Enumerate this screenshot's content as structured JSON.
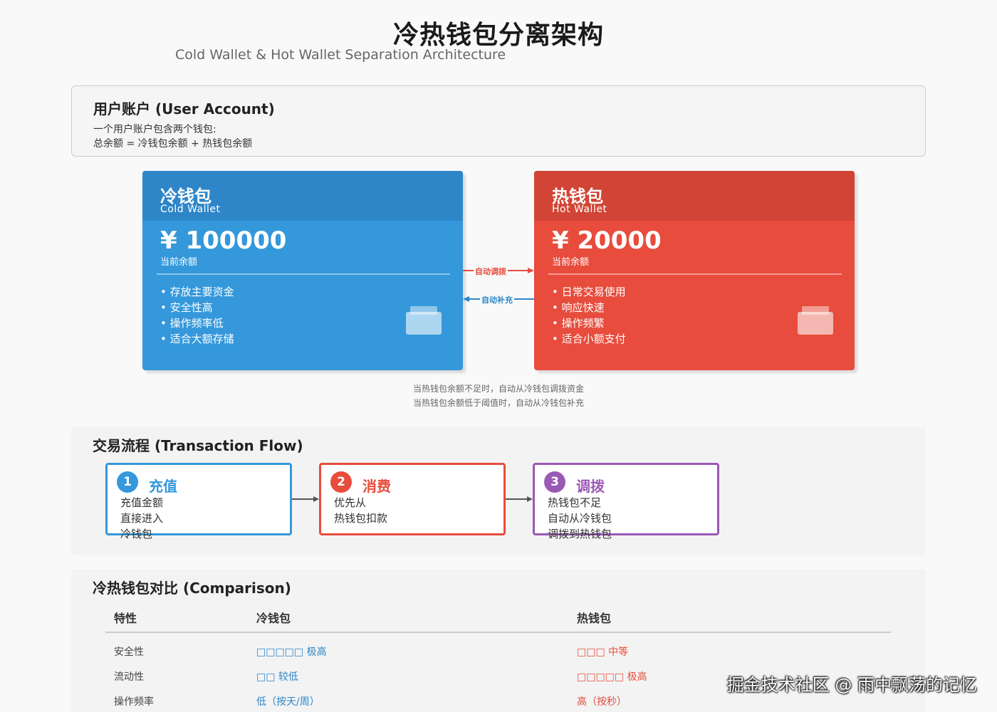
{
  "header": {
    "title": "冷热钱包分离架构",
    "subtitle": "Cold Wallet & Hot Wallet Separation Architecture"
  },
  "user_account": {
    "title": "用户账户 (User Account)",
    "line1": "一个用户账户包含两个钱包:",
    "line2": "总余额 = 冷钱包余额 + 热钱包余额"
  },
  "cold_wallet": {
    "name": "冷钱包",
    "en": "Cold Wallet",
    "amount": "¥ 100000",
    "amount_label": "当前余额",
    "features": [
      "• 存放主要资金",
      "• 安全性高",
      "• 操作频率低",
      "• 适合大额存储"
    ],
    "color": "#3498db",
    "icon": "wallet-icon"
  },
  "hot_wallet": {
    "name": "热钱包",
    "en": "Hot Wallet",
    "amount": "¥ 20000",
    "amount_label": "当前余额",
    "features": [
      "• 日常交易使用",
      "• 响应快速",
      "• 操作频繁",
      "• 适合小额支付"
    ],
    "color": "#e74c3c",
    "icon": "wallet-icon"
  },
  "arrows": {
    "to_hot": "自动调拨",
    "to_cold": "自动补充"
  },
  "notes": {
    "line1": "当热钱包余额不足时，自动从冷钱包调拨资金",
    "line2": "当热钱包余额低于阈值时，自动从冷钱包补充"
  },
  "flow": {
    "title": "交易流程 (Transaction Flow)",
    "steps": [
      {
        "num": "1",
        "title": "充值",
        "lines": [
          "充值金额",
          "直接进入",
          "冷钱包"
        ],
        "color": "#3498db"
      },
      {
        "num": "2",
        "title": "消费",
        "lines": [
          "优先从",
          "热钱包扣款"
        ],
        "color": "#e74c3c"
      },
      {
        "num": "3",
        "title": "调拨",
        "lines": [
          "热钱包不足",
          "自动从冷钱包",
          "调拨到热钱包"
        ],
        "color": "#9b59b6"
      }
    ]
  },
  "comparison": {
    "title": "冷热钱包对比 (Comparison)",
    "headers": [
      "特性",
      "冷钱包",
      "热钱包"
    ],
    "rows": [
      [
        "安全性",
        "□□□□□ 极高",
        "□□□ 中等"
      ],
      [
        "流动性",
        "□□ 较低",
        "□□□□□ 极高"
      ],
      [
        "操作频率",
        "低（按天/周）",
        "高（按秒）"
      ]
    ]
  },
  "watermark": "掘金技术社区 @ 雨中飘荡的记忆"
}
